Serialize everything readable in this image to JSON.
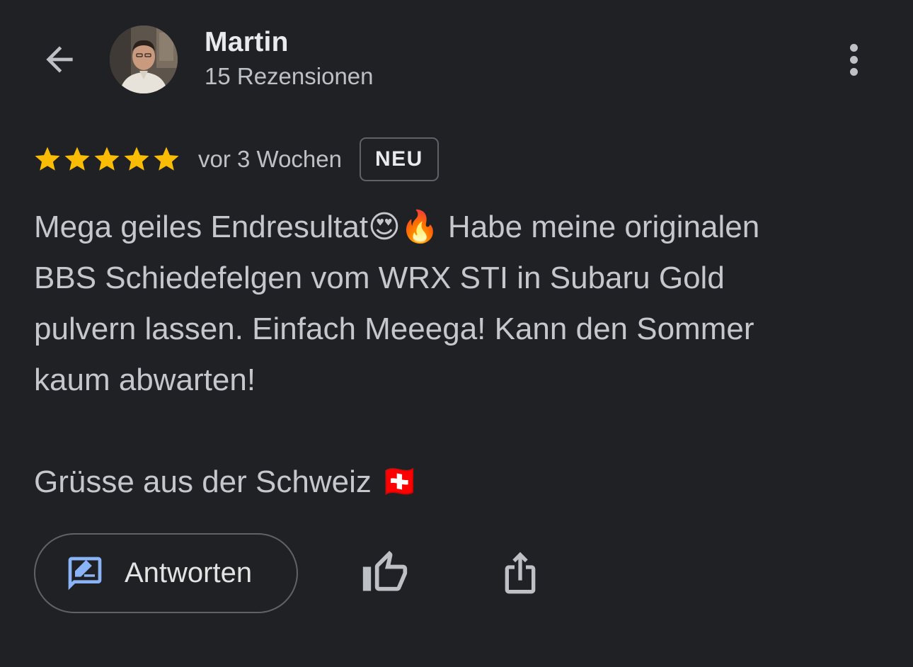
{
  "header": {
    "back_icon": "arrow-back-icon",
    "user_name": "Martin",
    "review_count": "15 Rezensionen",
    "more_icon": "more-vert-icon"
  },
  "review": {
    "rating": 5,
    "rating_max": 5,
    "star_color": "#FBBC04",
    "date": "vor 3 Wochen",
    "badge": "NEU",
    "text": "Mega geiles Endresultat😍🔥 Habe meine originalen\nBBS Schiedefelgen vom WRX STI in Subaru Gold\npulvern lassen. Einfach Meeega! Kann den Sommer\nkaum abwarten!",
    "greeting": "Grüsse aus der Schweiz 🇨🇭"
  },
  "actions": {
    "reply_label": "Antworten",
    "reply_icon": "rate-review-icon",
    "reply_icon_color": "#8AB4F8",
    "like_icon": "thumb-up-icon",
    "share_icon": "share-icon"
  }
}
